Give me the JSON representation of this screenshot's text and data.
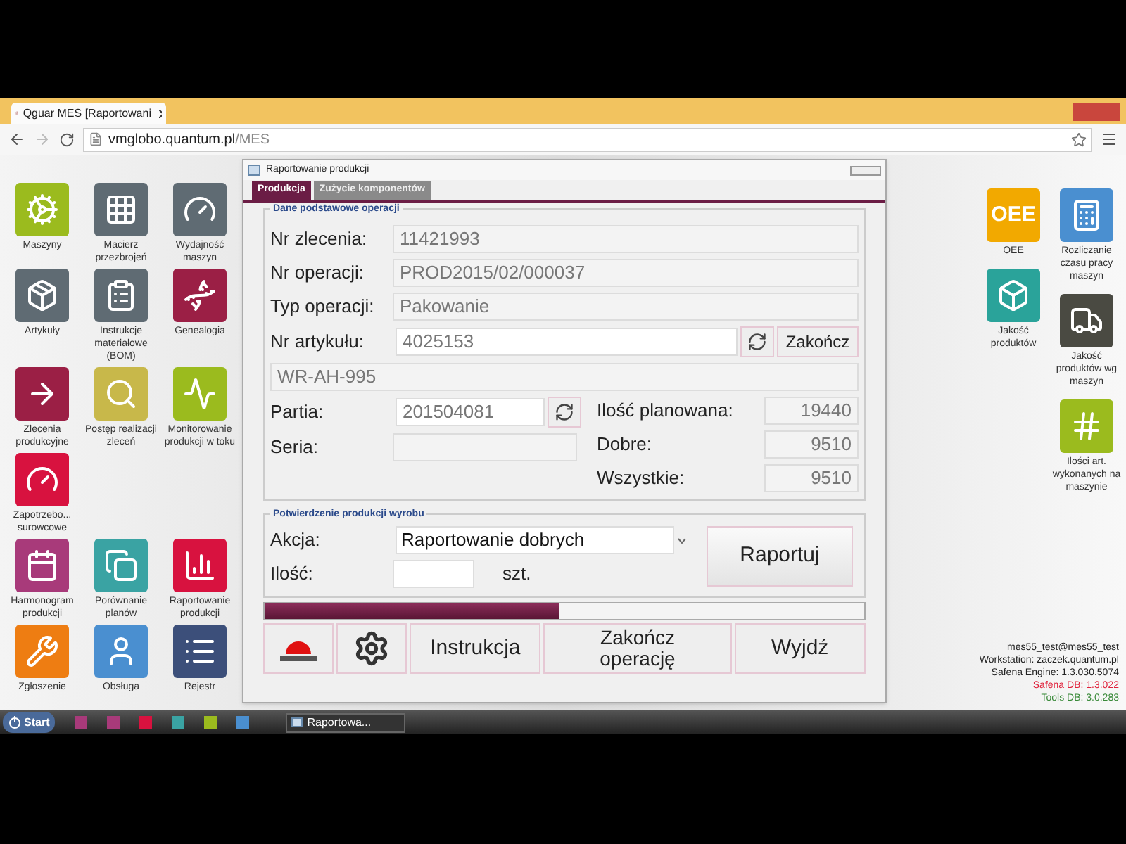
{
  "browser": {
    "tab_title": "Qguar MES [Raportowani",
    "url_host": "vmglobo.quantum.pl",
    "url_path": "/MES"
  },
  "left_icons": [
    [
      {
        "label": "Maszyny",
        "color": "#9bbb1e"
      },
      {
        "label": "Macierz przezbrojeń",
        "color": "#5f6b73"
      },
      {
        "label": "Wydajność maszyn",
        "color": "#5f6b73"
      }
    ],
    [
      {
        "label": "Artykuły",
        "color": "#5f6b73"
      },
      {
        "label": "Instrukcje materiałowe (BOM)",
        "color": "#5f6b73"
      },
      {
        "label": "Genealogia",
        "color": "#9b1f45"
      }
    ],
    [
      {
        "label": "Zlecenia produkcyjne",
        "color": "#9b1f45"
      },
      {
        "label": "Postęp realizacji zleceń",
        "color": "#c8b84a"
      },
      {
        "label": "Monitorowanie produkcji w toku",
        "color": "#9bbb1e"
      }
    ],
    [
      {
        "label": "Zapotrzebo... surowcowe",
        "color": "#d8123f"
      }
    ],
    [
      {
        "label": "Harmonogram produkcji",
        "color": "#a83a7a"
      },
      {
        "label": "Porównanie planów",
        "color": "#3aa3a3"
      },
      {
        "label": "Raportowanie produkcji",
        "color": "#d8123f"
      }
    ],
    [
      {
        "label": "Zgłoszenie",
        "color": "#ee7d12"
      },
      {
        "label": "Obsługa",
        "color": "#4a8fd0"
      },
      {
        "label": "Rejestr",
        "color": "#3c4f7a"
      }
    ]
  ],
  "right_icons": [
    [
      {
        "label": "OEE",
        "tile_text": "OEE",
        "color": "#f2a900"
      },
      {
        "label": "Jakość produktów",
        "color": "#2aa39a"
      }
    ],
    [
      {
        "label": "Rozliczanie czasu pracy maszyn",
        "color": "#4a8fd0"
      },
      {
        "label": "Jakość produktów wg maszyn",
        "color": "#4a4a42"
      },
      {
        "label": "Ilości art. wykonanych na maszynie",
        "color": "#9bbb1e"
      }
    ]
  ],
  "dialog": {
    "title": "Raportowanie produkcji",
    "tabs": [
      {
        "label": "Produkcja",
        "selected": true
      },
      {
        "label": "Zużycie komponentów",
        "selected": false
      }
    ],
    "basic_group": {
      "title": "Dane podstawowe operacji",
      "order_label": "Nr zlecenia:",
      "order_value": "11421993",
      "operation_label": "Nr operacji:",
      "operation_value": "PROD2015/02/000037",
      "type_label": "Typ operacji:",
      "type_value": "Pakowanie",
      "article_label": "Nr artykułu:",
      "article_value": "4025153",
      "finish_button": "Zakończ",
      "article_name": "WR-AH-995",
      "batch_label": "Partia:",
      "batch_value": "201504081",
      "series_label": "Seria:",
      "planned_label": "Ilość planowana:",
      "planned_value": "19440",
      "good_label": "Dobre:",
      "good_value": "9510",
      "all_label": "Wszystkie:",
      "all_value": "9510"
    },
    "confirm_group": {
      "title": "Potwierdzenie produkcji wyrobu",
      "action_label": "Akcja:",
      "action_value": "Raportowanie dobrych",
      "quantity_label": "Ilość:",
      "unit": "szt.",
      "report_button": "Raportuj"
    },
    "progress": {
      "level": 0.49
    },
    "buttons": {
      "instruction": "Instrukcja",
      "finish": "Zakończ operację",
      "exit": "Wyjdź"
    }
  },
  "status_lines": [
    {
      "text": "mes55_test@mes55_test",
      "color": "#222222"
    },
    {
      "text": "Workstation: zaczek.quantum.pl",
      "color": "#222222"
    },
    {
      "text": "Safena Engine: 1.3.030.5074",
      "color": "#222222"
    },
    {
      "text": "Safena DB: 1.3.022",
      "color": "#e0203a"
    },
    {
      "text": "Tools DB: 3.0.283",
      "color": "#3a8a3a"
    }
  ],
  "taskbar": {
    "start": "Start",
    "quick_launch": [
      {
        "color": "#a83a7a"
      },
      {
        "color": "#a83a7a"
      },
      {
        "color": "#d8123f"
      },
      {
        "color": "#3aa3a3"
      },
      {
        "color": "#9bbb1e"
      },
      {
        "color": "#4a8fd0"
      }
    ],
    "task": "Raportowa..."
  }
}
